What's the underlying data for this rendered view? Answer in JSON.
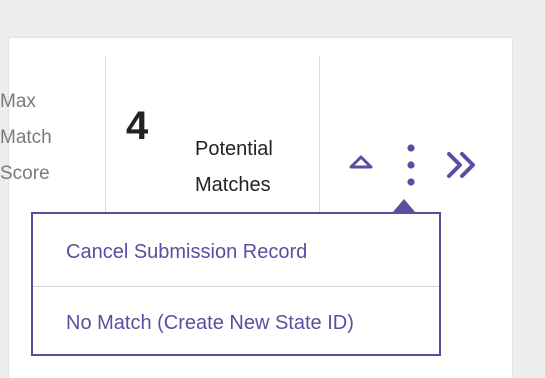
{
  "score": {
    "label_lines": [
      "Max",
      "Match",
      "Score"
    ]
  },
  "matches": {
    "count": "4",
    "label_lines": [
      "Potential",
      "Matches"
    ]
  },
  "actions": {
    "collapse_icon": "chevron-up-icon",
    "more_icon": "kebab-menu-icon",
    "expand_icon": "double-chevron-right-icon"
  },
  "menu": {
    "items": [
      {
        "label": "Cancel Submission Record"
      },
      {
        "label": "No Match (Create New State ID)"
      }
    ]
  },
  "colors": {
    "accent": "#5b4ea0",
    "text": "#222222",
    "muted": "#7a7a7a",
    "divider": "#dcdcdc",
    "background": "#eeeeee"
  }
}
